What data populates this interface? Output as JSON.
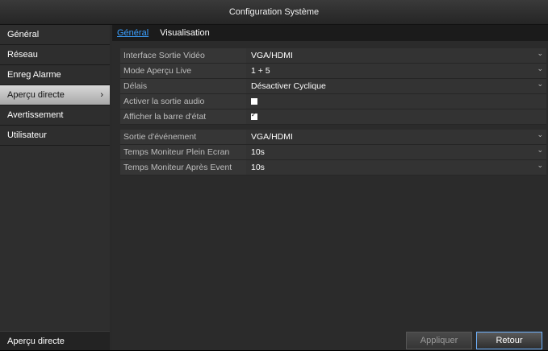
{
  "window": {
    "title": "Configuration Système"
  },
  "sidebar": {
    "items": [
      {
        "label": "Général"
      },
      {
        "label": "Réseau"
      },
      {
        "label": "Enreg Alarme"
      },
      {
        "label": "Aperçu directe",
        "chevron": "›"
      },
      {
        "label": "Avertissement"
      },
      {
        "label": "Utilisateur"
      }
    ],
    "bottom_label": "Aperçu directe"
  },
  "tabs": [
    {
      "label": "Général"
    },
    {
      "label": "Visualisation"
    }
  ],
  "settings": [
    {
      "label": "Interface Sortie Vidéo",
      "value": "VGA/HDMI"
    },
    {
      "label": "Mode Aperçu Live",
      "value": "1 + 5"
    },
    {
      "label": "Délais",
      "value": "Désactiver Cyclique"
    },
    {
      "label": "Activer la sortie audio",
      "checked": false
    },
    {
      "label": "Afficher la barre d'état",
      "checked": true
    },
    {
      "label": "Sortie d'événement",
      "value": "VGA/HDMI"
    },
    {
      "label": "Temps Moniteur Plein Ecran",
      "value": "10s"
    },
    {
      "label": "Temps Moniteur Après Event",
      "value": "10s"
    }
  ],
  "buttons": {
    "apply": "Appliquer",
    "back": "Retour"
  },
  "colors": {
    "accent": "#3ba0ff",
    "active_item": "#c0c0c0"
  }
}
